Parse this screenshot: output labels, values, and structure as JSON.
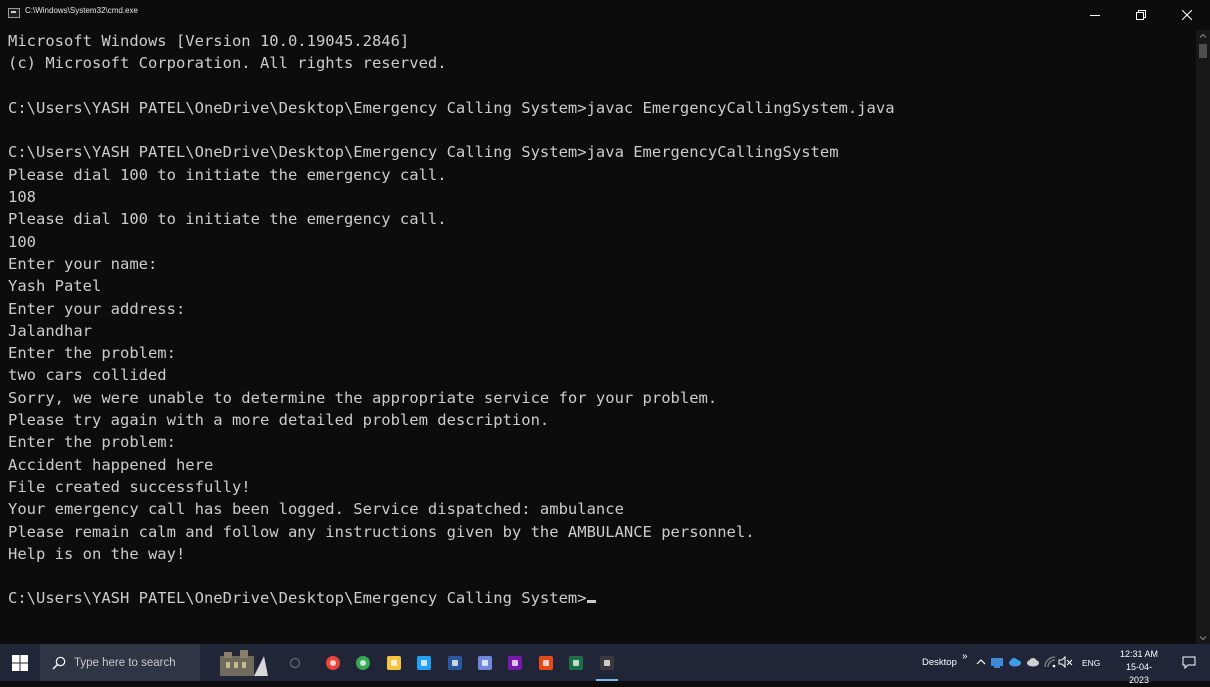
{
  "window": {
    "title": "C:\\Windows\\System32\\cmd.exe"
  },
  "console": {
    "lines": [
      "Microsoft Windows [Version 10.0.19045.2846]",
      "(c) Microsoft Corporation. All rights reserved.",
      "",
      "C:\\Users\\YASH PATEL\\OneDrive\\Desktop\\Emergency Calling System>javac EmergencyCallingSystem.java",
      "",
      "C:\\Users\\YASH PATEL\\OneDrive\\Desktop\\Emergency Calling System>java EmergencyCallingSystem",
      "Please dial 100 to initiate the emergency call.",
      "108",
      "Please dial 100 to initiate the emergency call.",
      "100",
      "Enter your name:",
      "Yash Patel",
      "Enter your address:",
      "Jalandhar",
      "Enter the problem:",
      "two cars collided",
      "Sorry, we were unable to determine the appropriate service for your problem.",
      "Please try again with a more detailed problem description.",
      "Enter the problem:",
      "Accident happened here",
      "File created successfully!",
      "Your emergency call has been logged. Service dispatched: ambulance",
      "Please remain calm and follow any instructions given by the AMBULANCE personnel.",
      "Help is on the way!",
      ""
    ],
    "prompt": "C:\\Users\\YASH PATEL\\OneDrive\\Desktop\\Emergency Calling System>"
  },
  "taskbar": {
    "search_placeholder": "Type here to search",
    "desktop_label": "Desktop",
    "overflow_label": "»",
    "language": "ENG",
    "clock_time": "12:31 AM",
    "clock_date": "15-04-2023",
    "pinned_apps": [
      {
        "icon": "chrome-icon",
        "color": "#e8453c"
      },
      {
        "icon": "chrome-alt-icon",
        "color": "#34a853"
      },
      {
        "icon": "file-explorer-icon",
        "color": "#f5c542"
      },
      {
        "icon": "vscode-icon",
        "color": "#23a0f2"
      },
      {
        "icon": "word-icon",
        "color": "#2b579a"
      },
      {
        "icon": "pen-app-icon",
        "color": "#6f88d9"
      },
      {
        "icon": "onenote-icon",
        "color": "#7719aa"
      },
      {
        "icon": "office-icon",
        "color": "#e64a19"
      },
      {
        "icon": "excel-icon",
        "color": "#1d7044"
      },
      {
        "icon": "command-prompt-icon",
        "color": "#3a3a3a"
      }
    ]
  },
  "colors": {
    "console_bg": "#0c0c0c",
    "console_text": "#cccccc",
    "taskbar_bg": "#202638"
  }
}
